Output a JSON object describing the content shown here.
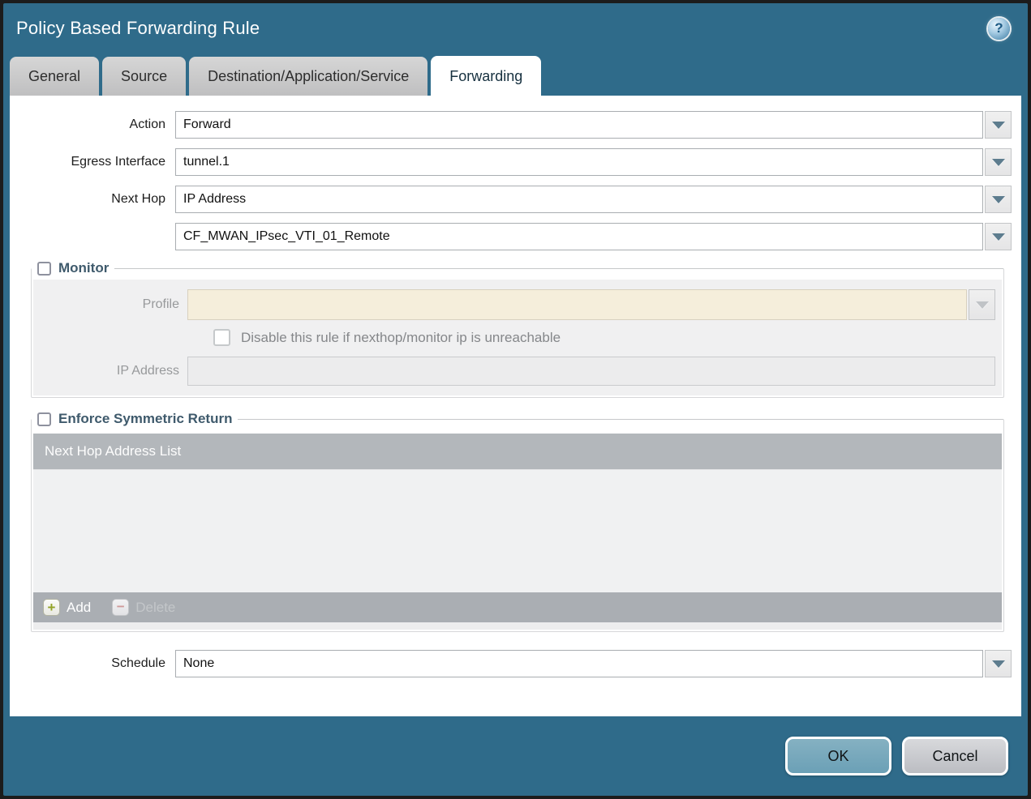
{
  "dialog": {
    "title": "Policy Based Forwarding Rule",
    "help_glyph": "?",
    "tabs": [
      {
        "label": "General",
        "active": false
      },
      {
        "label": "Source",
        "active": false
      },
      {
        "label": "Destination/Application/Service",
        "active": false
      },
      {
        "label": "Forwarding",
        "active": true
      }
    ],
    "form": {
      "action": {
        "label": "Action",
        "value": "Forward"
      },
      "egress_interface": {
        "label": "Egress Interface",
        "value": "tunnel.1"
      },
      "next_hop": {
        "label": "Next Hop",
        "value": "IP Address"
      },
      "next_hop_address": {
        "value": "CF_MWAN_IPsec_VTI_01_Remote"
      },
      "schedule": {
        "label": "Schedule",
        "value": "None"
      }
    },
    "monitor": {
      "legend": "Monitor",
      "checked": false,
      "profile": {
        "label": "Profile",
        "value": "",
        "disabled": true
      },
      "disable_rule": {
        "label": "Disable this rule if nexthop/monitor ip is unreachable",
        "checked": false,
        "disabled": true
      },
      "ip_address": {
        "label": "IP Address",
        "value": "",
        "disabled": true
      }
    },
    "enforce_symmetric_return": {
      "legend": "Enforce Symmetric Return",
      "checked": false,
      "table": {
        "header": "Next Hop Address List",
        "rows": []
      },
      "toolbar": {
        "add_label": "Add",
        "delete_label": "Delete",
        "delete_disabled": true
      }
    },
    "footer": {
      "ok_label": "OK",
      "cancel_label": "Cancel"
    },
    "colors": {
      "frame_teal": "#2f6b8a",
      "inactive_tab_bg": "#c6c6c7",
      "active_tab_bg": "#ffffff",
      "legend_text": "#3f5a6c",
      "table_header_bg": "#b3b7bb",
      "toolbar_bg": "#aaaeb3",
      "profile_disabled_bg": "#f5eedb",
      "dropdown_arrow": "#5d7c8e",
      "add_icon_plus": "#93a326",
      "delete_icon_minus": "#cf9a9a",
      "ok_button_bg": "#74a7bc",
      "cancel_button_bg": "#c9cbd0"
    }
  }
}
